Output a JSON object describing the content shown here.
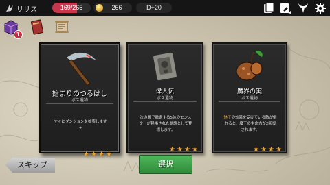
{
  "topbar": {
    "player_name": "リリス",
    "hp_text": "169/265",
    "hp_fraction": 0.64,
    "gold": "266",
    "day": "D+20",
    "icons": [
      "card-icon",
      "deck-icon",
      "demon-horns-icon",
      "gear-icon"
    ]
  },
  "side_icons": {
    "items": [
      "purple-chest-icon",
      "red-book-icon",
      "scroll-icon"
    ],
    "badge_count": "1"
  },
  "cards": [
    {
      "title": "始まりのつるはし",
      "subtitle": "ボス遺物",
      "desc_lines": [
        "すぐにダンジョンを拡張します",
        "+"
      ],
      "stars": 4,
      "icon": "pickaxe-icon"
    },
    {
      "title": "偉人伝",
      "subtitle": "ボス遺物",
      "desc_lines": [
        "次の層で撤退する5体のモンス",
        "ターが昇格された状態として登",
        "場します。"
      ],
      "stars": 4,
      "icon": "stone-book-icon"
    },
    {
      "title": "魔界の実",
      "subtitle": "ボス遺物",
      "desc_pre": "魅了",
      "desc_lines": [
        "の効果を受けている敵が倒",
        "れると、魔王の生命力が2回復",
        "されます。"
      ],
      "stars": 4,
      "icon": "demon-fruit-icon"
    }
  ],
  "buttons": {
    "skip": "スキップ",
    "select": "選択"
  },
  "colors": {
    "hp": "#c8364d",
    "star": "#e6a437",
    "select_button": "#3fa04a",
    "highlight_text": "#e4a23a"
  }
}
